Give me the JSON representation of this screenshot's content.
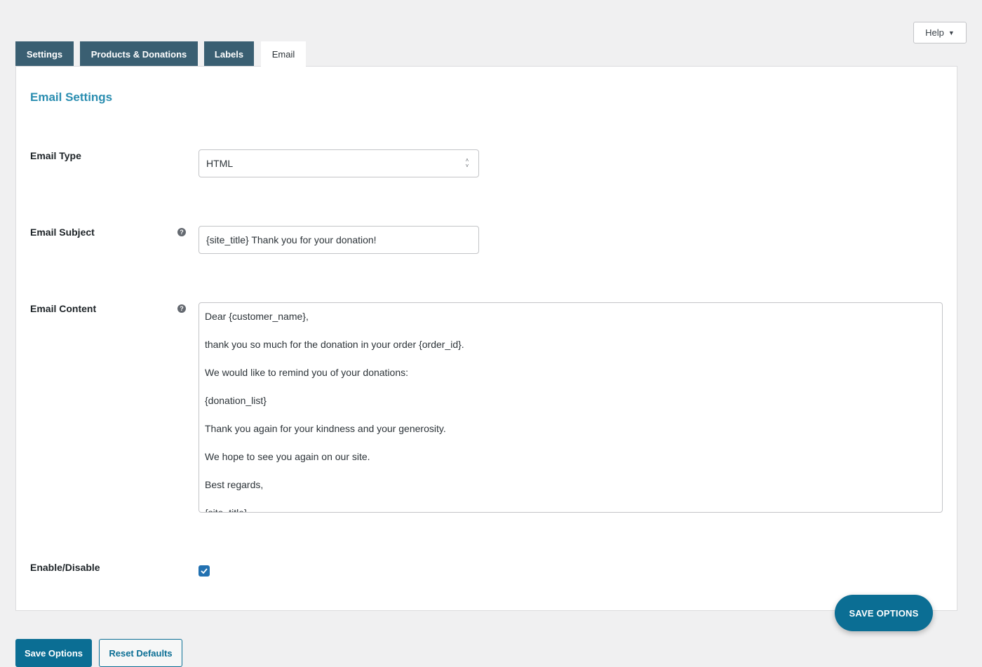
{
  "help": {
    "label": "Help"
  },
  "tabs": [
    {
      "label": "Settings",
      "active": false
    },
    {
      "label": "Products & Donations",
      "active": false
    },
    {
      "label": "Labels",
      "active": false
    },
    {
      "label": "Email",
      "active": true
    }
  ],
  "section_title": "Email Settings",
  "fields": {
    "email_type": {
      "label": "Email Type",
      "value": "HTML"
    },
    "email_subject": {
      "label": "Email Subject",
      "value": "{site_title} Thank you for your donation!"
    },
    "email_content": {
      "label": "Email Content",
      "lines": [
        "Dear {customer_name},",
        "thank you so much for the donation in your order {order_id}.",
        "We would like to remind you of your donations:",
        "{donation_list}",
        "Thank you again for your kindness and your generosity.",
        "We hope to see you again on our site.",
        "Best regards,",
        "{site_title}"
      ]
    },
    "enable": {
      "label": "Enable/Disable",
      "checked": true
    }
  },
  "buttons": {
    "float_save": "SAVE OPTIONS",
    "save": "Save Options",
    "reset": "Reset Defaults"
  },
  "colors": {
    "tab_inactive": "#3a5f72",
    "accent_title": "#2a8db0",
    "primary": "#0b6e94",
    "checkbox": "#2271b1"
  }
}
